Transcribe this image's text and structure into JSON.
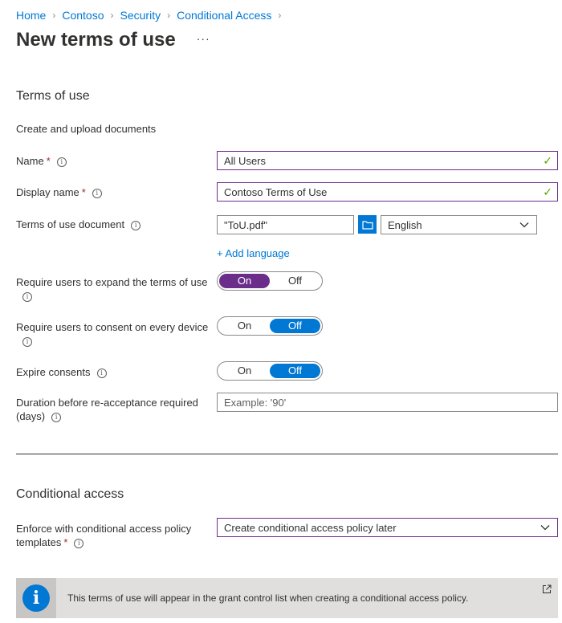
{
  "breadcrumb": [
    "Home",
    "Contoso",
    "Security",
    "Conditional Access"
  ],
  "page": {
    "title": "New terms of use",
    "more": "···"
  },
  "tou": {
    "section_title": "Terms of use",
    "subtitle": "Create and upload documents",
    "name_label": "Name",
    "name_value": "All Users",
    "display_label": "Display name",
    "display_value": "Contoso Terms of Use",
    "doc_label": "Terms of use document",
    "doc_value": "\"ToU.pdf\"",
    "language_value": "English",
    "add_language": "+ Add language",
    "expand_label": "Require users to expand the terms of use",
    "device_label": "Require users to consent on every device",
    "expire_label": "Expire consents",
    "duration_label": "Duration before re-acceptance required (days)",
    "duration_placeholder": "Example: '90'",
    "on": "On",
    "off": "Off"
  },
  "ca": {
    "section_title": "Conditional access",
    "enforce_label": "Enforce with conditional access policy templates",
    "enforce_value": "Create conditional access policy later"
  },
  "banner": {
    "text": "This terms of use will appear in the grant control list when creating a conditional access policy."
  },
  "colors": {
    "accent": "#0078d4",
    "purple": "#6b2d8a",
    "valid": "#57a300"
  },
  "icons": {
    "info": "info-icon",
    "check": "check-icon",
    "folder": "folder-icon",
    "chevron": "chevron-down-icon",
    "external": "external-link-icon"
  }
}
